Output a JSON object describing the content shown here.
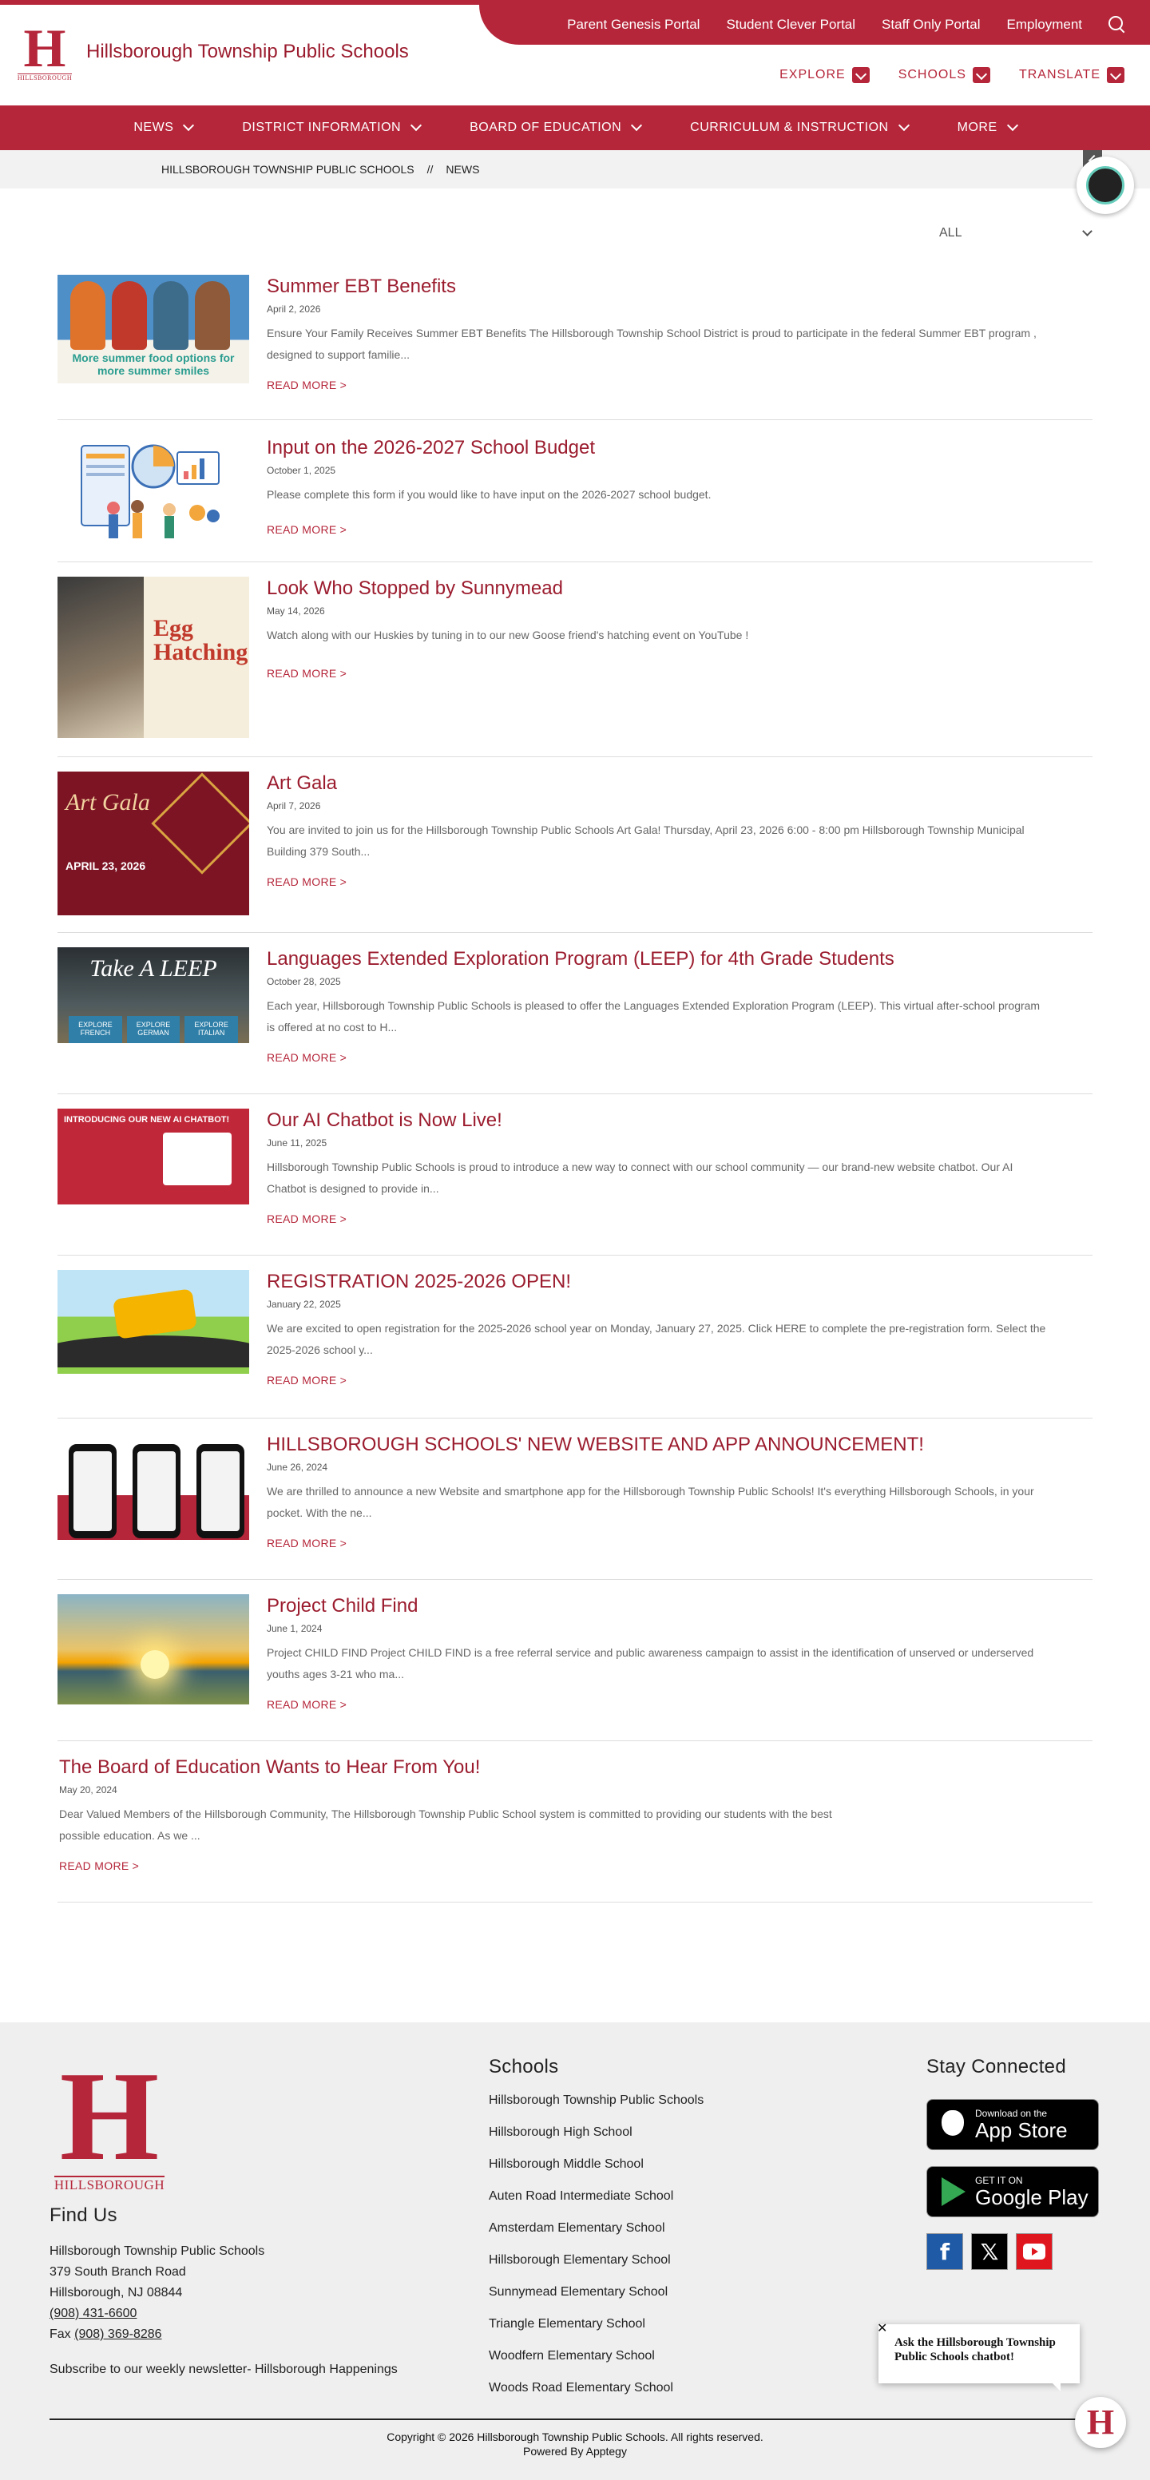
{
  "top_links": [
    "Parent Genesis Portal",
    "Student Clever Portal",
    "Staff Only Portal",
    "Employment"
  ],
  "site": {
    "title": "Hillsborough Township Public Schools",
    "logo_letter": "H",
    "logo_text": "HILLSBOROUGH"
  },
  "header_dropdowns": [
    "EXPLORE",
    "SCHOOLS",
    "TRANSLATE"
  ],
  "main_nav": [
    "NEWS",
    "DISTRICT INFORMATION",
    "BOARD OF EDUCATION",
    "CURRICULUM & INSTRUCTION",
    "MORE"
  ],
  "breadcrumb": {
    "root": "HILLSBOROUGH TOWNSHIP PUBLIC SCHOOLS",
    "sep": "//",
    "current": "NEWS"
  },
  "filter": {
    "selected": "ALL"
  },
  "posts": [
    {
      "title": "Summer EBT Benefits",
      "date": "April 2, 2026",
      "excerpt": "Ensure Your Family Receives Summer EBT Benefits The Hillsborough Township School District is proud to participate in the federal Summer EBT program , designed to support familie...",
      "more": "READ MORE >",
      "thumb_caption": "More summer food options for more summer smiles"
    },
    {
      "title": "Input on the 2026-2027 School Budget",
      "date": "October 1, 2025",
      "excerpt": "Please complete this form if you would like to have input on the 2026-2027 school budget.",
      "more": "READ MORE >"
    },
    {
      "title": "Look Who Stopped by Sunnymead",
      "date": "May 14, 2026",
      "excerpt": "Watch along with our Huskies by tuning in to our new Goose friend's hatching event on YouTube !",
      "more": "READ MORE >",
      "thumb_caption": "Egg Hatching"
    },
    {
      "title": "Art Gala",
      "date": "April 7, 2026",
      "excerpt": "You are invited to join us for the Hillsborough Township Public Schools Art Gala! Thursday, April 23, 2026 6:00 - 8:00 pm Hillsborough Township Municipal Building 379 South...",
      "more": "READ MORE >",
      "thumb_caption": "Art Gala",
      "thumb_date": "APRIL 23, 2026"
    },
    {
      "title": "Languages Extended Exploration Program (LEEP) for 4th Grade Students",
      "date": "October 28, 2025",
      "excerpt": "Each year, Hillsborough Township Public Schools is pleased to offer the Languages Extended Exploration Program (LEEP). This virtual after-school program is offered at no cost to H...",
      "more": "READ MORE >",
      "thumb_caption": "Take A LEEP",
      "thumb_tabs": [
        "EXPLORE FRENCH",
        "EXPLORE GERMAN",
        "EXPLORE ITALIAN"
      ]
    },
    {
      "title": "Our AI Chatbot is Now Live!",
      "date": "June 11, 2025",
      "excerpt": "Hillsborough Township Public Schools is proud to introduce a new way to connect with our school community — our brand-new website chatbot. Our AI Chatbot is designed to provide in...",
      "more": "READ MORE >",
      "thumb_caption": "INTRODUCING OUR NEW AI CHATBOT!"
    },
    {
      "title": "REGISTRATION 2025-2026 OPEN!",
      "date": "January 22, 2025",
      "excerpt": "We are excited to open registration for the 2025-2026 school year on Monday, January 27, 2025. Click HERE to complete the pre-registration form. Select the 2025-2026 school y...",
      "more": "READ MORE >"
    },
    {
      "title": "HILLSBOROUGH SCHOOLS' NEW WEBSITE AND APP ANNOUNCEMENT!",
      "date": "June 26, 2024",
      "excerpt": "We are thrilled to announce a new Website and smartphone app for the Hillsborough Township Public Schools! It's everything Hillsborough Schools, in your pocket. With the ne...",
      "more": "READ MORE >"
    },
    {
      "title": "Project Child Find",
      "date": "June 1, 2024",
      "excerpt": "Project CHILD FIND Project CHILD FIND is a free referral service and public awareness campaign to assist in the identification of unserved or underserved youths ages 3-21 who ma...",
      "more": "READ MORE >"
    },
    {
      "title": "The Board of Education Wants to Hear From You!",
      "date": "May 20, 2024",
      "excerpt": "Dear Valued Members of the Hillsborough Community, The Hillsborough Township Public School system is committed to providing our students with the best possible education. As we ...",
      "more": "READ MORE >"
    }
  ],
  "footer": {
    "find_us": {
      "heading": "Find Us",
      "name": "Hillsborough Township Public Schools",
      "address1": "379 South Branch Road",
      "address2": "Hillsborough, NJ 08844",
      "phone": "(908) 431-6600",
      "fax_label": "Fax",
      "fax": "(908) 369-8286",
      "newsletter": "Subscribe to our weekly newsletter- Hillsborough Happenings"
    },
    "schools": {
      "heading": "Schools",
      "items": [
        "Hillsborough Township Public Schools",
        "Hillsborough High School",
        "Hillsborough Middle School",
        "Auten Road Intermediate School",
        "Amsterdam Elementary School",
        "Hillsborough Elementary School",
        "Sunnymead Elementary School",
        "Triangle Elementary School",
        "Woodfern Elementary School",
        "Woods Road Elementary School"
      ]
    },
    "connect": {
      "heading": "Stay Connected",
      "app_store": {
        "line1": "Download on the",
        "line2": "App Store"
      },
      "google_play": {
        "line1": "GET IT ON",
        "line2": "Google Play"
      },
      "socials": [
        "facebook-icon",
        "x-icon",
        "youtube-icon"
      ]
    },
    "copyright": "Copyright © 2026 Hillsborough Township Public Schools. All rights reserved.",
    "powered": "Powered By Apptegy"
  },
  "chat": {
    "text": "Ask the Hillsborough Township Public Schools chatbot!",
    "close": "✕"
  },
  "colors": {
    "brand": "#b5263a",
    "title": "#9b1c2e"
  }
}
